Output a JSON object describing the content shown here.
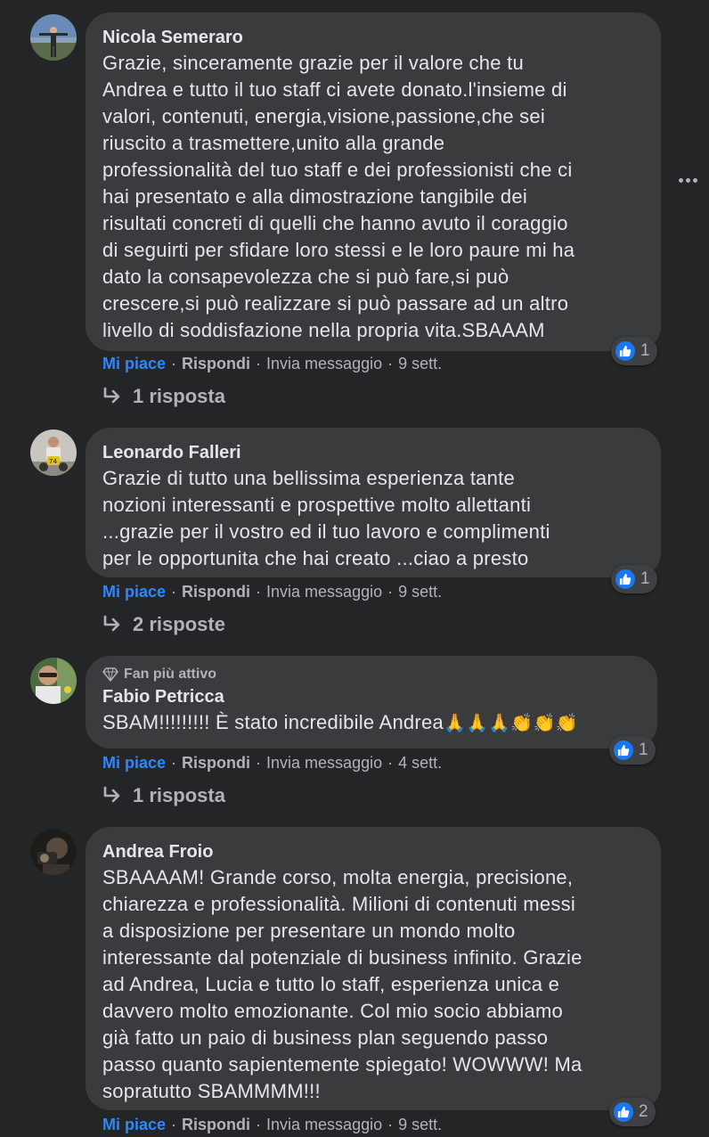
{
  "colors": {
    "background": "#242526",
    "bubble": "#3a3b3c",
    "like_blue": "#2d88ff",
    "text": "#e4e6eb",
    "muted": "#b0b3b8"
  },
  "actions": {
    "like": "Mi piace",
    "reply": "Rispondi",
    "message": "Invia messaggio"
  },
  "comments": [
    {
      "author": "Nicola Semeraro",
      "text": [
        "Grazie, sinceramente grazie per il valore che tu",
        "Andrea e tutto il tuo staff ci avete donato.l'insieme di",
        "valori, contenuti, energia,visione,passione,che sei",
        "riuscito a trasmettere,unito alla grande",
        "professionalità del tuo staff e dei professionisti che ci",
        "hai presentato e alla dimostrazione tangibile dei",
        "risultati concreti di quelli che hanno avuto il coraggio",
        "di seguirti per sfidare loro stessi e le loro paure mi ha",
        "dato la consapevolezza che si può fare,si può",
        "crescere,si può realizzare si può passare ad un altro",
        "livello di soddisfazione nella propria vita.SBAAAM"
      ],
      "reactions": "1",
      "time": "9 sett.",
      "replies": "1 risposta"
    },
    {
      "author": "Leonardo Falleri",
      "text": [
        "Grazie di tutto una bellissima esperienza tante",
        "nozioni interessanti e prospettive molto allettanti",
        "...grazie per il vostro ed il tuo lavoro e complimenti",
        "per le opportunita che hai creato ...ciao a presto"
      ],
      "reactions": "1",
      "time": "9 sett.",
      "replies": "2 risposte"
    },
    {
      "badge": "Fan più attivo",
      "author": "Fabio Petricca",
      "text": [
        "SBAM!!!!!!!!! È stato incredibile Andrea"
      ],
      "emojis": "🙏🙏🙏👏👏👏",
      "reactions": "1",
      "time": "4 sett.",
      "replies": "1 risposta"
    },
    {
      "author": "Andrea Froio",
      "text": [
        "SBAAAAM! Grande corso, molta energia, precisione,",
        "chiarezza e professionalità. Milioni di contenuti messi",
        "a disposizione per presentare un mondo molto",
        "interessante dal potenziale di business infinito. Grazie",
        "ad Andrea, Lucia e tutto lo staff, esperienza unica e",
        "davvero molto emozionante. Col mio socio abbiamo",
        "già fatto un paio di business plan seguendo passo",
        "passo quanto sapientemente spiegato! WOWWW! Ma",
        "sopratutto SBAMMMM!!!"
      ],
      "reactions": "2",
      "time": "9 sett."
    }
  ]
}
